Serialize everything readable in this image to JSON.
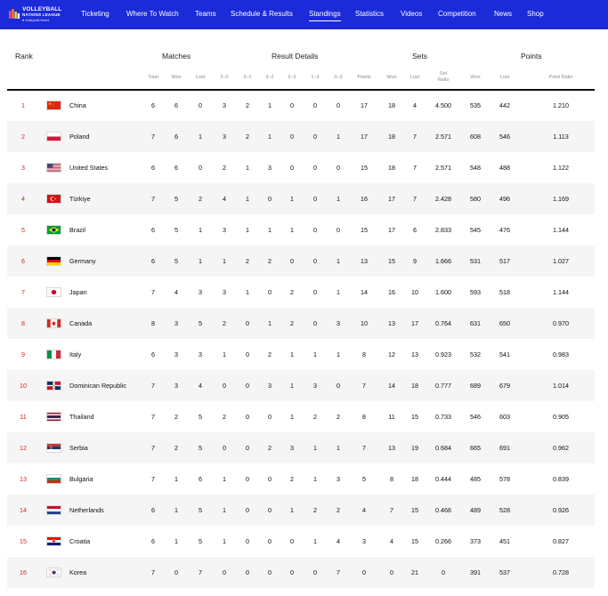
{
  "brand": {
    "line1": "VOLLEYBALL",
    "line2": "NATIONS LEAGUE",
    "line3": "♥ Volleyball World"
  },
  "nav": {
    "items": [
      "Ticketing",
      "Where To Watch",
      "Teams",
      "Schedule & Results",
      "Standings",
      "Statistics",
      "Videos",
      "Competition",
      "News",
      "Shop"
    ],
    "active": "Standings"
  },
  "table": {
    "group_headers": {
      "rank": "Rank",
      "matches": "Matches",
      "result_details": "Result Details",
      "sets": "Sets",
      "points": "Points"
    },
    "sub_headers": [
      "Total",
      "Won",
      "Lost",
      "3–0",
      "3–1",
      "3–2",
      "2–3",
      "1–3",
      "0–3",
      "Points",
      "Won",
      "Lost",
      "Set Ratio",
      "Won",
      "Lost",
      "Point Ratio"
    ],
    "rows": [
      {
        "rank": "1",
        "team": "China",
        "flag": "cn",
        "cells": [
          "6",
          "6",
          "0",
          "3",
          "2",
          "1",
          "0",
          "0",
          "0",
          "17",
          "18",
          "4",
          "4.500",
          "535",
          "442",
          "1.210"
        ]
      },
      {
        "rank": "2",
        "team": "Poland",
        "flag": "pl",
        "cells": [
          "7",
          "6",
          "1",
          "3",
          "2",
          "1",
          "0",
          "0",
          "1",
          "17",
          "18",
          "7",
          "2.571",
          "608",
          "546",
          "1.113"
        ]
      },
      {
        "rank": "3",
        "team": "United States",
        "flag": "us",
        "cells": [
          "6",
          "6",
          "0",
          "2",
          "1",
          "3",
          "0",
          "0",
          "0",
          "15",
          "18",
          "7",
          "2.571",
          "548",
          "488",
          "1.122"
        ]
      },
      {
        "rank": "4",
        "team": "Türkiye",
        "flag": "tr",
        "cells": [
          "7",
          "5",
          "2",
          "4",
          "1",
          "0",
          "1",
          "0",
          "1",
          "16",
          "17",
          "7",
          "2.428",
          "580",
          "496",
          "1.169"
        ]
      },
      {
        "rank": "5",
        "team": "Brazil",
        "flag": "br",
        "cells": [
          "6",
          "5",
          "1",
          "3",
          "1",
          "1",
          "1",
          "0",
          "0",
          "15",
          "17",
          "6",
          "2.833",
          "545",
          "476",
          "1.144"
        ]
      },
      {
        "rank": "6",
        "team": "Germany",
        "flag": "de",
        "cells": [
          "6",
          "5",
          "1",
          "1",
          "2",
          "2",
          "0",
          "0",
          "1",
          "13",
          "15",
          "9",
          "1.666",
          "531",
          "517",
          "1.027"
        ]
      },
      {
        "rank": "7",
        "team": "Japan",
        "flag": "jp",
        "cells": [
          "7",
          "4",
          "3",
          "3",
          "1",
          "0",
          "2",
          "0",
          "1",
          "14",
          "16",
          "10",
          "1.600",
          "593",
          "518",
          "1.144"
        ]
      },
      {
        "rank": "8",
        "team": "Canada",
        "flag": "ca",
        "cells": [
          "8",
          "3",
          "5",
          "2",
          "0",
          "1",
          "2",
          "0",
          "3",
          "10",
          "13",
          "17",
          "0.764",
          "631",
          "650",
          "0.970"
        ]
      },
      {
        "rank": "9",
        "team": "Italy",
        "flag": "it",
        "cells": [
          "6",
          "3",
          "3",
          "1",
          "0",
          "2",
          "1",
          "1",
          "1",
          "8",
          "12",
          "13",
          "0.923",
          "532",
          "541",
          "0.983"
        ]
      },
      {
        "rank": "10",
        "team": "Dominican Republic",
        "flag": "do",
        "cells": [
          "7",
          "3",
          "4",
          "0",
          "0",
          "3",
          "1",
          "3",
          "0",
          "7",
          "14",
          "18",
          "0.777",
          "689",
          "679",
          "1.014"
        ]
      },
      {
        "rank": "11",
        "team": "Thailand",
        "flag": "th",
        "cells": [
          "7",
          "2",
          "5",
          "2",
          "0",
          "0",
          "1",
          "2",
          "2",
          "8",
          "11",
          "15",
          "0.733",
          "546",
          "603",
          "0.905"
        ]
      },
      {
        "rank": "12",
        "team": "Serbia",
        "flag": "rs",
        "cells": [
          "7",
          "2",
          "5",
          "0",
          "0",
          "2",
          "3",
          "1",
          "1",
          "7",
          "13",
          "19",
          "0.684",
          "665",
          "691",
          "0.962"
        ]
      },
      {
        "rank": "13",
        "team": "Bulgaria",
        "flag": "bg",
        "cells": [
          "7",
          "1",
          "6",
          "1",
          "0",
          "0",
          "2",
          "1",
          "3",
          "5",
          "8",
          "18",
          "0.444",
          "485",
          "578",
          "0.839"
        ]
      },
      {
        "rank": "14",
        "team": "Netherlands",
        "flag": "nl",
        "cells": [
          "6",
          "1",
          "5",
          "1",
          "0",
          "0",
          "1",
          "2",
          "2",
          "4",
          "7",
          "15",
          "0.466",
          "489",
          "528",
          "0.926"
        ]
      },
      {
        "rank": "15",
        "team": "Croatia",
        "flag": "hr",
        "cells": [
          "6",
          "1",
          "5",
          "1",
          "0",
          "0",
          "0",
          "1",
          "4",
          "3",
          "4",
          "15",
          "0.266",
          "373",
          "451",
          "0.827"
        ]
      },
      {
        "rank": "16",
        "team": "Korea",
        "flag": "kr",
        "cells": [
          "7",
          "0",
          "7",
          "0",
          "0",
          "0",
          "0",
          "0",
          "7",
          "0",
          "0",
          "21",
          "0",
          "391",
          "537",
          "0.728"
        ]
      }
    ]
  },
  "colors": {
    "nav_bg": "#1b2bd8",
    "rank_text": "#e02020",
    "alt_row": "#f5f5f5"
  }
}
